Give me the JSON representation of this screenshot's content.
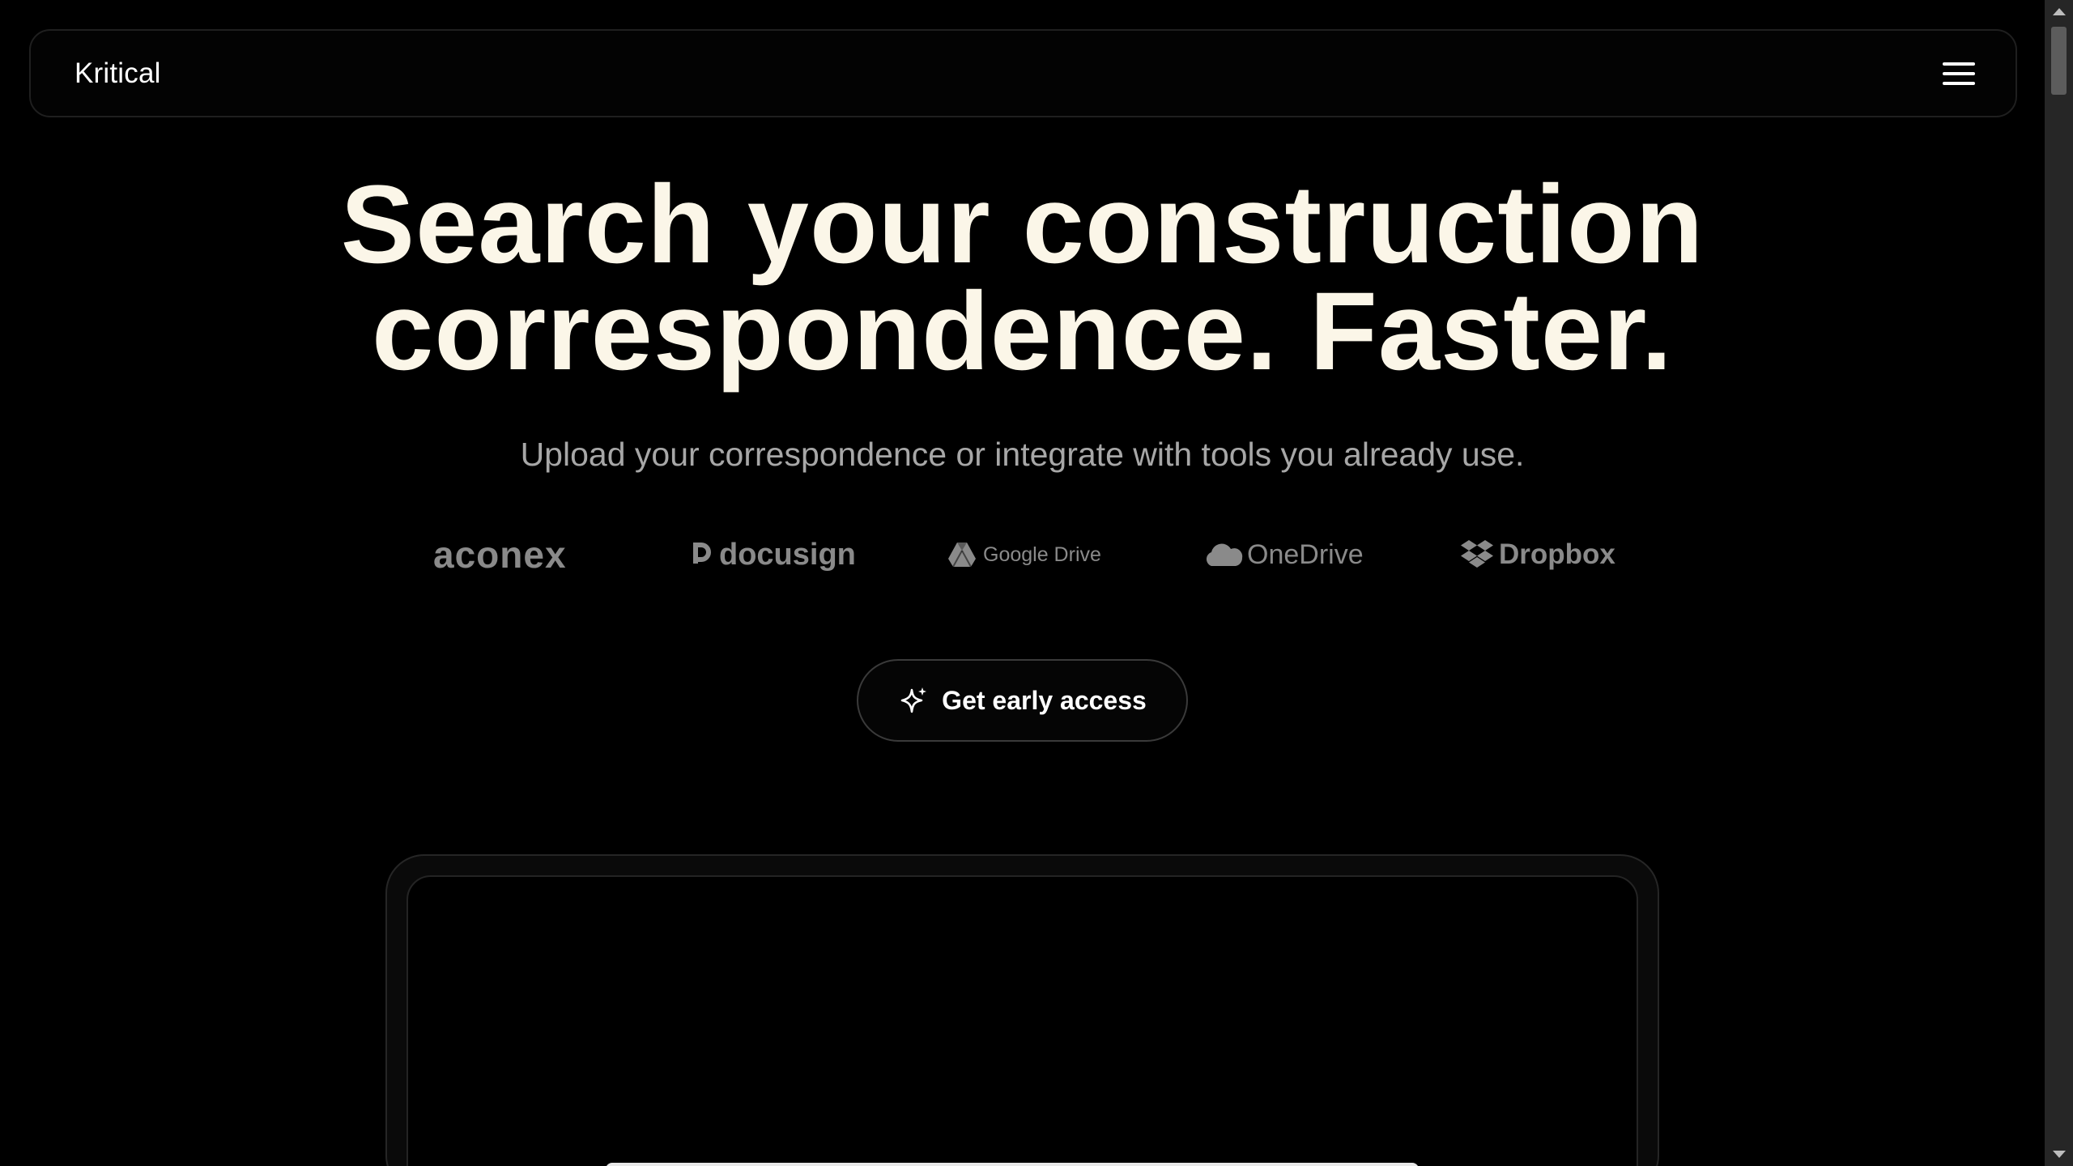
{
  "header": {
    "brand": "Kritical",
    "menu_icon": "hamburger-menu-icon"
  },
  "hero": {
    "title_line1": "Search your construction",
    "title_line2": "correspondence. Faster.",
    "subtitle": "Upload your correspondence or integrate with tools you already use."
  },
  "integrations": {
    "items": [
      {
        "label": "aconex",
        "icon": "aconex-logo"
      },
      {
        "label": "docusign",
        "icon": "docusign-icon"
      },
      {
        "label": "Google Drive",
        "icon": "google-drive-icon"
      },
      {
        "label": "OneDrive",
        "icon": "onedrive-cloud-icon"
      },
      {
        "label": "Dropbox",
        "icon": "dropbox-icon"
      }
    ]
  },
  "cta": {
    "label": "Get early access",
    "icon": "sparkle-icon"
  },
  "colors": {
    "background": "#000000",
    "heading": "#fbf6e8",
    "subtitle": "#a7a7a7",
    "logo": "#8a8a8a",
    "border": "#1f1f1f"
  }
}
